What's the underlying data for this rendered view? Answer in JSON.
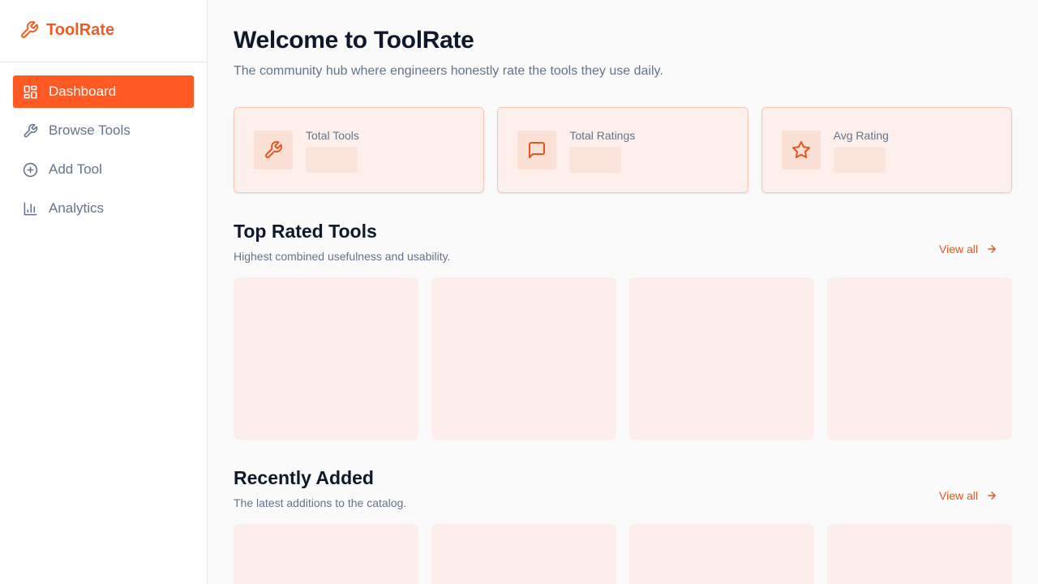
{
  "sidebar": {
    "brand": {
      "name": "ToolRate",
      "icon": "wrench-icon"
    },
    "items": [
      {
        "label": "Dashboard",
        "icon": "dashboard-icon",
        "active": true
      },
      {
        "label": "Browse Tools",
        "icon": "wrench-icon",
        "active": false
      },
      {
        "label": "Add Tool",
        "icon": "plus-circle-icon",
        "active": false
      },
      {
        "label": "Analytics",
        "icon": "bar-chart-icon",
        "active": false
      }
    ]
  },
  "header": {
    "title": "Welcome to ToolRate",
    "subtitle": "The community hub where engineers honestly rate the tools they use daily."
  },
  "stats": [
    {
      "label": "Total Tools",
      "icon": "wrench-icon"
    },
    {
      "label": "Total Ratings",
      "icon": "message-square-icon"
    },
    {
      "label": "Avg Rating",
      "icon": "star-icon"
    }
  ],
  "sections": {
    "top_rated": {
      "title": "Top Rated Tools",
      "subtitle": "Highest combined usefulness and usability.",
      "view_all": "View all"
    },
    "recent": {
      "title": "Recently Added",
      "subtitle": "The latest additions to the catalog.",
      "view_all": "View all"
    }
  },
  "colors": {
    "accent": "#ff5a24",
    "accent_text": "#e8541f",
    "skeleton": "#fcefeb",
    "card_bg": "#fdf0ec"
  }
}
